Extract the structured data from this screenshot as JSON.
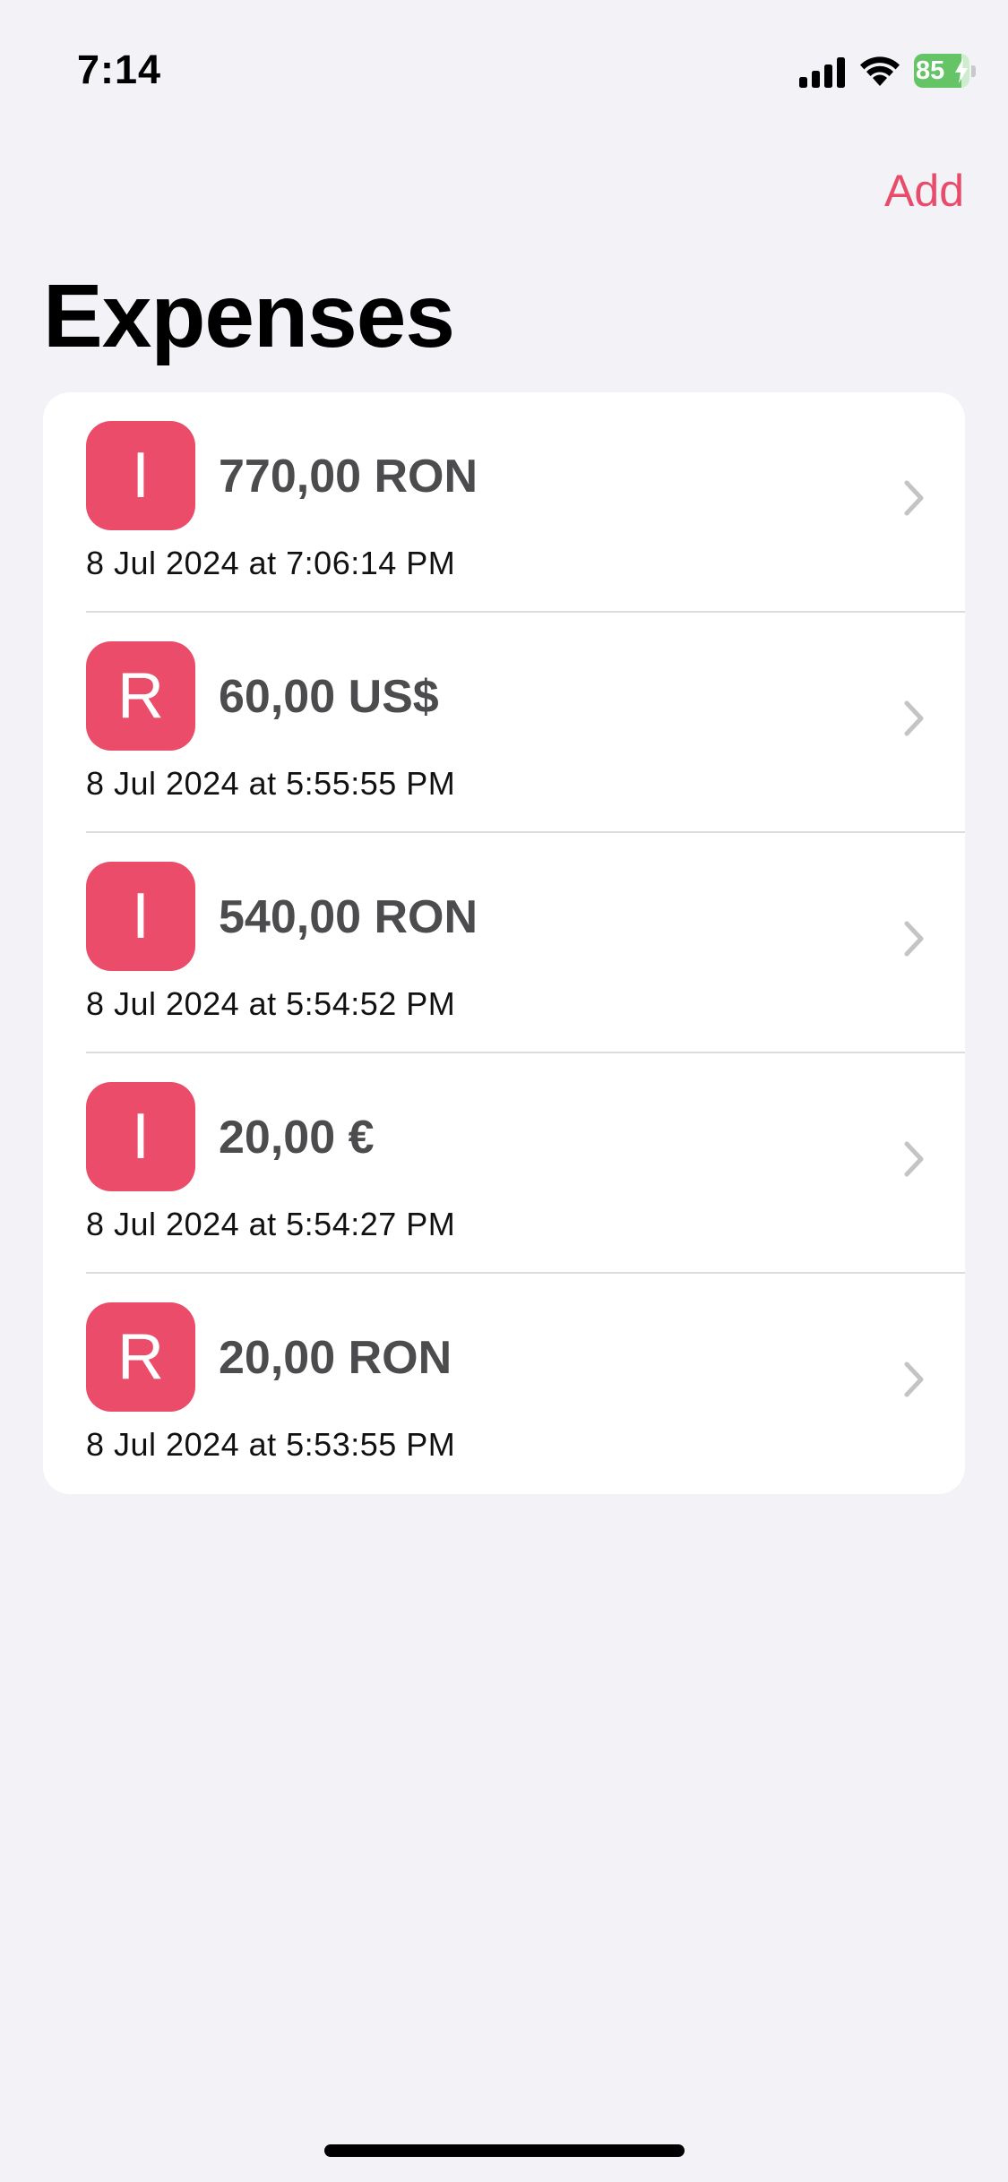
{
  "status_bar": {
    "time": "7:14",
    "battery_level": "85",
    "battery_fraction": 0.85,
    "icons": [
      "signal-icon",
      "wifi-icon",
      "battery-icon",
      "charging-bolt-icon"
    ]
  },
  "nav": {
    "add_label": "Add"
  },
  "title": "Expenses",
  "colors": {
    "accent": "#e94b6a",
    "badge": "#ea4c69",
    "background": "#f2f2f7",
    "card": "#ffffff",
    "amount_text": "#4c4c4e",
    "battery_green": "#65c466"
  },
  "expenses": [
    {
      "badge": "I",
      "amount": "770,00 RON",
      "date": "8 Jul 2024 at 7:06:14 PM"
    },
    {
      "badge": "R",
      "amount": "60,00 US$",
      "date": "8 Jul 2024 at 5:55:55 PM"
    },
    {
      "badge": "I",
      "amount": "540,00 RON",
      "date": "8 Jul 2024 at 5:54:52 PM"
    },
    {
      "badge": "I",
      "amount": "20,00 €",
      "date": "8 Jul 2024 at 5:54:27 PM"
    },
    {
      "badge": "R",
      "amount": "20,00 RON",
      "date": "8 Jul 2024 at 5:53:55 PM"
    }
  ]
}
